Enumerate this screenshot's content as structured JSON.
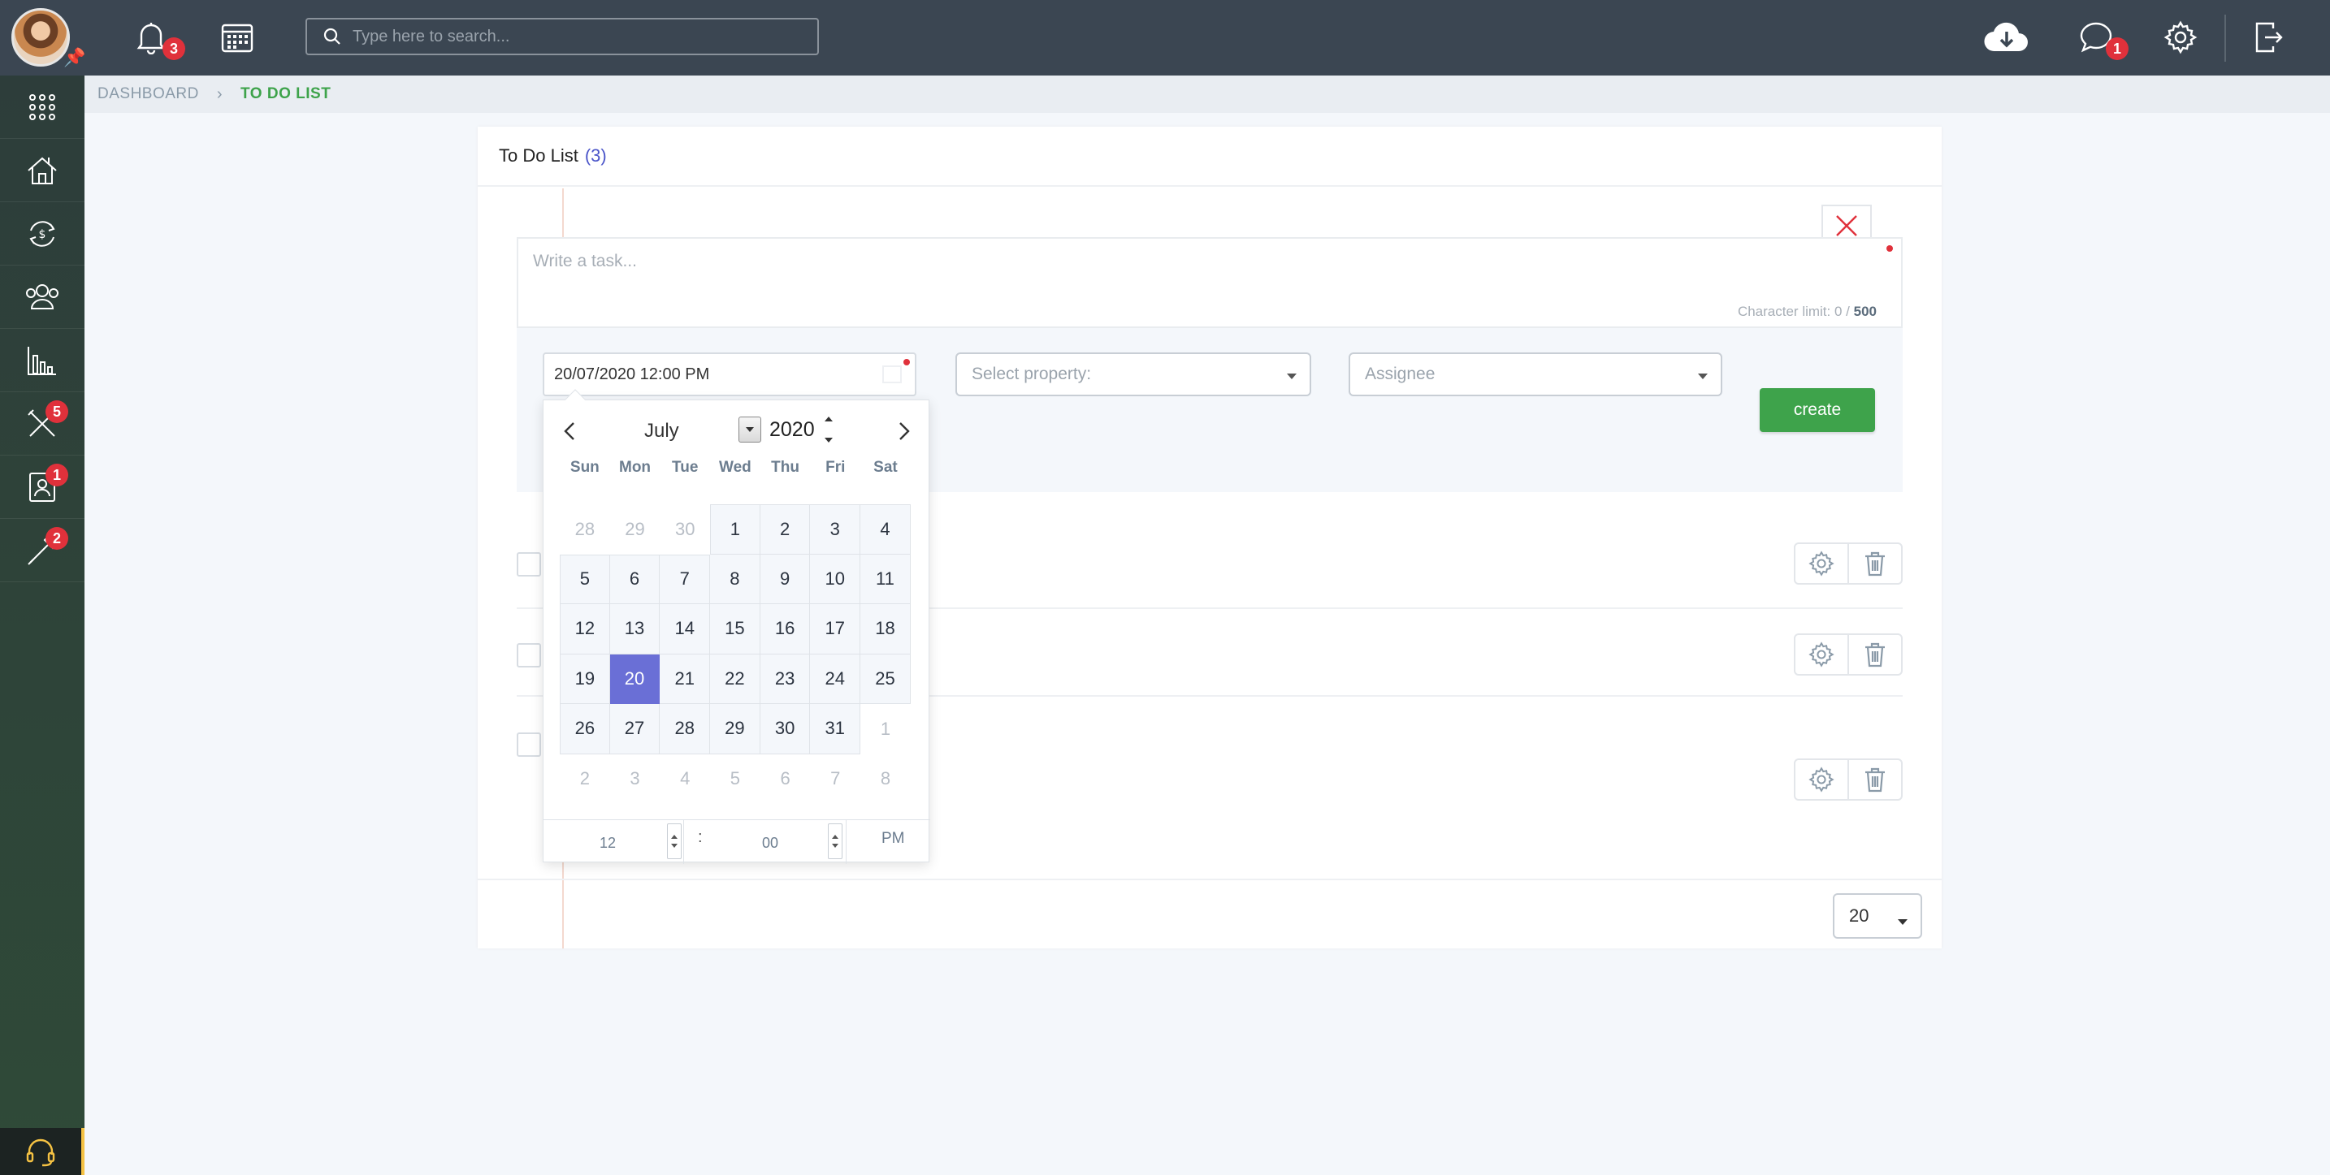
{
  "header": {
    "search_placeholder": "Type here to search...",
    "notifications_badge": "3",
    "messages_badge": "1"
  },
  "sidebar": {
    "items": [
      {
        "icon": "apps-grid-icon"
      },
      {
        "icon": "properties-icon"
      },
      {
        "icon": "finance-icon"
      },
      {
        "icon": "contacts-icon"
      },
      {
        "icon": "reports-icon"
      },
      {
        "icon": "maintenance-icon",
        "badge": "5"
      },
      {
        "icon": "tenant-icon",
        "badge": "1"
      },
      {
        "icon": "tools-icon",
        "badge": "2"
      }
    ],
    "bottom_icon": "support-headset-icon"
  },
  "breadcrumb": {
    "parent": "DASHBOARD",
    "current": "TO DO LIST"
  },
  "panel": {
    "title": "To Do List",
    "count": "(3)"
  },
  "task_form": {
    "placeholder": "Write a task...",
    "char_limit_label": "Character limit: 0 /",
    "char_limit_max": "500",
    "date_value": "20/07/2020 12:00 PM",
    "property_placeholder": "Select property:",
    "assignee_placeholder": "Assignee",
    "create_label": "create"
  },
  "pagination": {
    "page_size": "20"
  },
  "datepicker": {
    "month": "July",
    "year": "2020",
    "weekdays": [
      "Sun",
      "Mon",
      "Tue",
      "Wed",
      "Thu",
      "Fri",
      "Sat"
    ],
    "selected_day": "20",
    "days": [
      {
        "d": "28",
        "cur": false
      },
      {
        "d": "29",
        "cur": false
      },
      {
        "d": "30",
        "cur": false
      },
      {
        "d": "1",
        "cur": true
      },
      {
        "d": "2",
        "cur": true
      },
      {
        "d": "3",
        "cur": true
      },
      {
        "d": "4",
        "cur": true
      },
      {
        "d": "5",
        "cur": true
      },
      {
        "d": "6",
        "cur": true
      },
      {
        "d": "7",
        "cur": true
      },
      {
        "d": "8",
        "cur": true
      },
      {
        "d": "9",
        "cur": true
      },
      {
        "d": "10",
        "cur": true
      },
      {
        "d": "11",
        "cur": true
      },
      {
        "d": "12",
        "cur": true
      },
      {
        "d": "13",
        "cur": true
      },
      {
        "d": "14",
        "cur": true
      },
      {
        "d": "15",
        "cur": true
      },
      {
        "d": "16",
        "cur": true
      },
      {
        "d": "17",
        "cur": true
      },
      {
        "d": "18",
        "cur": true
      },
      {
        "d": "19",
        "cur": true
      },
      {
        "d": "20",
        "cur": true
      },
      {
        "d": "21",
        "cur": true
      },
      {
        "d": "22",
        "cur": true
      },
      {
        "d": "23",
        "cur": true
      },
      {
        "d": "24",
        "cur": true
      },
      {
        "d": "25",
        "cur": true
      },
      {
        "d": "26",
        "cur": true
      },
      {
        "d": "27",
        "cur": true
      },
      {
        "d": "28",
        "cur": true
      },
      {
        "d": "29",
        "cur": true
      },
      {
        "d": "30",
        "cur": true
      },
      {
        "d": "31",
        "cur": true
      },
      {
        "d": "1",
        "cur": false
      },
      {
        "d": "2",
        "cur": false
      },
      {
        "d": "3",
        "cur": false
      },
      {
        "d": "4",
        "cur": false
      },
      {
        "d": "5",
        "cur": false
      },
      {
        "d": "6",
        "cur": false
      },
      {
        "d": "7",
        "cur": false
      },
      {
        "d": "8",
        "cur": false
      }
    ],
    "hour": "12",
    "minute": "00",
    "ampm": "PM"
  },
  "colors": {
    "topbar": "#3b4652",
    "accent_green": "#3ea34b",
    "selected_day": "#6a6fd6",
    "badge_red": "#e0313b"
  }
}
